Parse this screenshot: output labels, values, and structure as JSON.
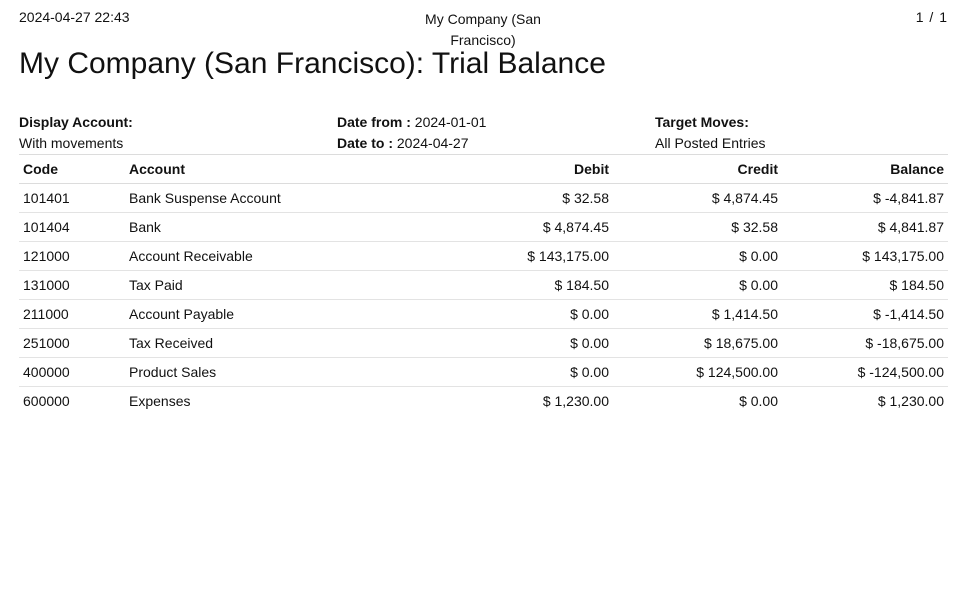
{
  "header": {
    "datetime": "2024-04-27 22:43",
    "company": "My Company (San Francisco)",
    "page": "1 / 1"
  },
  "title": "My Company (San Francisco): Trial Balance",
  "filters": {
    "display_account_label": "Display Account:",
    "display_account_value": "With movements",
    "date_from_label": "Date from :",
    "date_from_value": "2024-01-01",
    "date_to_label": "Date to :",
    "date_to_value": "2024-04-27",
    "target_moves_label": "Target Moves:",
    "target_moves_value": "All Posted Entries"
  },
  "table": {
    "columns": [
      "Code",
      "Account",
      "Debit",
      "Credit",
      "Balance"
    ],
    "rows": [
      {
        "code": "101401",
        "account": "Bank Suspense Account",
        "debit": "$ 32.58",
        "credit": "$ 4,874.45",
        "balance": "$ -4,841.87"
      },
      {
        "code": "101404",
        "account": "Bank",
        "debit": "$ 4,874.45",
        "credit": "$ 32.58",
        "balance": "$ 4,841.87"
      },
      {
        "code": "121000",
        "account": "Account Receivable",
        "debit": "$ 143,175.00",
        "credit": "$ 0.00",
        "balance": "$ 143,175.00"
      },
      {
        "code": "131000",
        "account": "Tax Paid",
        "debit": "$ 184.50",
        "credit": "$ 0.00",
        "balance": "$ 184.50"
      },
      {
        "code": "211000",
        "account": "Account Payable",
        "debit": "$ 0.00",
        "credit": "$ 1,414.50",
        "balance": "$ -1,414.50"
      },
      {
        "code": "251000",
        "account": "Tax Received",
        "debit": "$ 0.00",
        "credit": "$ 18,675.00",
        "balance": "$ -18,675.00"
      },
      {
        "code": "400000",
        "account": "Product Sales",
        "debit": "$ 0.00",
        "credit": "$ 124,500.00",
        "balance": "$ -124,500.00"
      },
      {
        "code": "600000",
        "account": "Expenses",
        "debit": "$ 1,230.00",
        "credit": "$ 0.00",
        "balance": "$ 1,230.00"
      }
    ]
  }
}
